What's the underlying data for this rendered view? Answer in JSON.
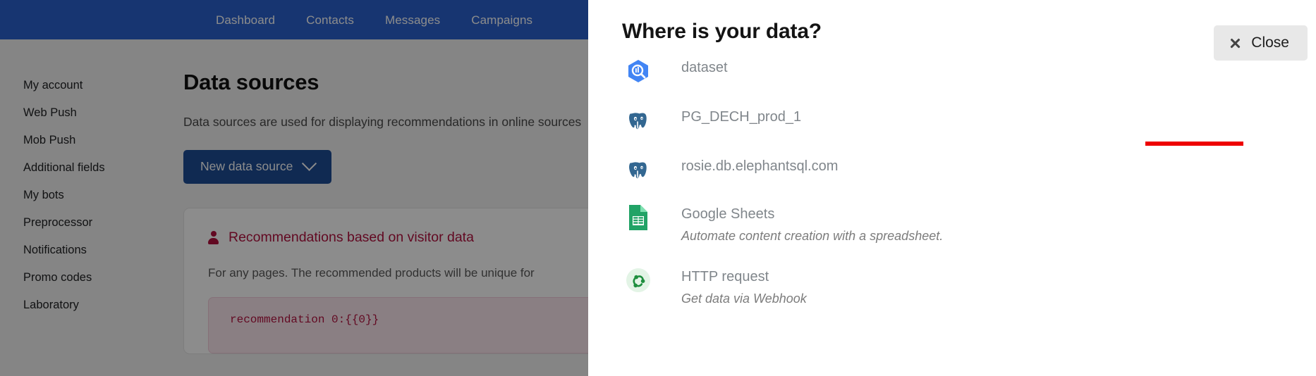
{
  "nav": {
    "items": [
      {
        "label": "Dashboard"
      },
      {
        "label": "Contacts"
      },
      {
        "label": "Messages"
      },
      {
        "label": "Campaigns"
      }
    ]
  },
  "sidebar": {
    "items": [
      {
        "label": "My account"
      },
      {
        "label": "Web Push"
      },
      {
        "label": "Mob Push"
      },
      {
        "label": "Additional fields"
      },
      {
        "label": "My bots"
      },
      {
        "label": "Preprocessor"
      },
      {
        "label": "Notifications"
      },
      {
        "label": "Promo codes"
      },
      {
        "label": "Laboratory"
      }
    ]
  },
  "main": {
    "title": "Data sources",
    "description": "Data sources are used for displaying recommendations in online sources",
    "new_data_source_button": "New data source",
    "card": {
      "title": "Recommendations based on visitor data",
      "subtitle": "For any pages. The recommended products will be unique for",
      "code_snippet": "recommendation 0:{{0}}"
    }
  },
  "modal": {
    "title": "Where is your data?",
    "close_label": "Close",
    "sources": [
      {
        "label": "dataset",
        "description": "",
        "icon": "bigquery-dataset-icon",
        "annotated": true
      },
      {
        "label": "PG_DECH_prod_1",
        "description": "",
        "icon": "postgresql-icon",
        "annotated": false
      },
      {
        "label": "rosie.db.elephantsql.com",
        "description": "",
        "icon": "postgresql-icon",
        "annotated": false
      },
      {
        "label": "Google Sheets",
        "description": "Automate content creation with a spreadsheet.",
        "icon": "google-sheets-icon",
        "annotated": false
      },
      {
        "label": "HTTP request",
        "description": "Get data via Webhook",
        "icon": "webhook-icon",
        "annotated": false
      }
    ]
  },
  "colors": {
    "nav_blue": "#2a62ce",
    "button_blue": "#1e4d96",
    "accent_red": "#b3123f",
    "annotation_red": "#ee0000",
    "sheets_green": "#21a366",
    "postgres_blue": "#336791"
  }
}
